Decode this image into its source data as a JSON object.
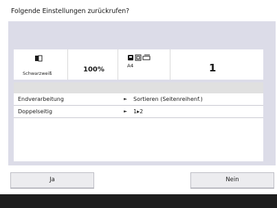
{
  "dialog": {
    "title": "Folgende Einstellungen zurückrufen?"
  },
  "summary": {
    "color_mode_label": "Schwarzweiß",
    "color_mode_icon": "bw-copy-icon",
    "zoom": "100%",
    "paper_size": "A4",
    "paper_icons": [
      "paper-drawer-icon",
      "paper-tray-icon",
      "paper-stack-icon"
    ],
    "copies": "1"
  },
  "settings": [
    {
      "name": "Endverarbeitung",
      "value": "Sortieren (Seitenreihenf.)"
    },
    {
      "name": "Doppelseitig",
      "value": "1▸2"
    }
  ],
  "buttons": {
    "yes": "Ja",
    "no": "Nein"
  }
}
